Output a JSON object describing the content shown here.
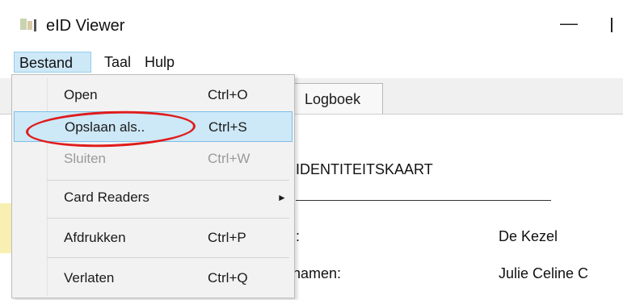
{
  "window": {
    "title": "eID Viewer",
    "minimize_glyph": "—"
  },
  "menubar": {
    "items": [
      {
        "label": "Bestand"
      },
      {
        "label": "Taal"
      },
      {
        "label": "Hulp"
      }
    ]
  },
  "dropdown": {
    "items": [
      {
        "label": "Open",
        "shortcut": "Ctrl+O",
        "state": "normal"
      },
      {
        "label": "Opslaan als..",
        "shortcut": "Ctrl+S",
        "state": "selected"
      },
      {
        "label": "Sluiten",
        "shortcut": "Ctrl+W",
        "state": "disabled"
      },
      {
        "label": "Card Readers",
        "shortcut": "",
        "submenu_arrow": "►",
        "state": "normal"
      },
      {
        "label": "Afdrukken",
        "shortcut": "Ctrl+P",
        "state": "normal"
      },
      {
        "label": "Verlaten",
        "shortcut": "Ctrl+Q",
        "state": "normal"
      }
    ]
  },
  "main": {
    "tab_label": "Logboek",
    "card_title": "IDENTITEITSKAART",
    "fields": [
      {
        "label": ":",
        "value": "De Kezel"
      },
      {
        "label": "namen:",
        "value": "Julie Celine C"
      }
    ]
  },
  "annotations": {
    "circle_color": "#e01b1b",
    "highlight_color": "#f5eb9a"
  },
  "colors": {
    "menu_selected_bg": "#cde8f7",
    "menu_bg": "#f2f2f2"
  }
}
